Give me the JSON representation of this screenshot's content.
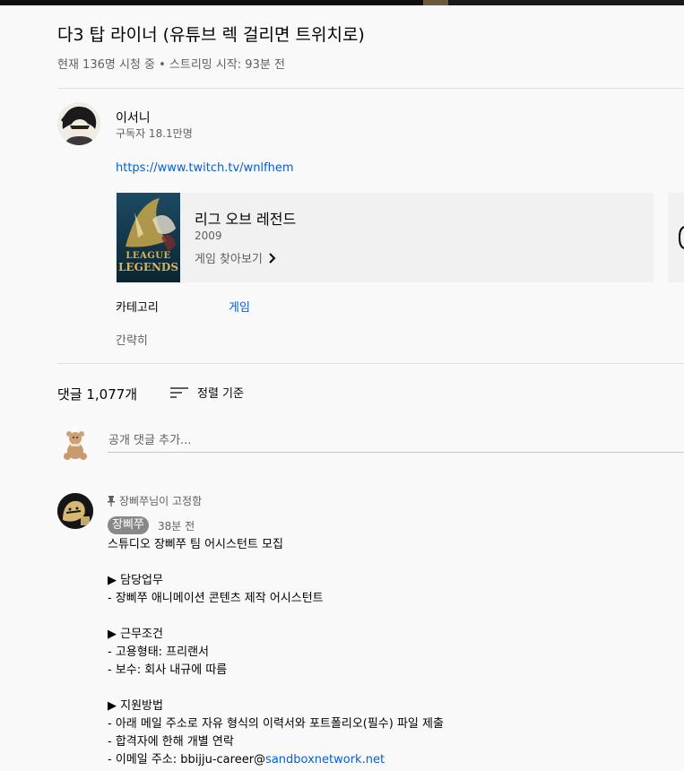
{
  "video": {
    "title": "다3 탑 라이너 (유튜브 렉 걸리면 트위치로)",
    "meta": "현재 136명 시청 중 • 스트리밍 시작: 93분 전"
  },
  "owner": {
    "name": "이서니",
    "subscribers": "구독자 18.1만명"
  },
  "description": {
    "link": "https://www.twitch.tv/wnlfhem"
  },
  "game": {
    "title": "리그 오브 레전드",
    "year": "2009",
    "browse_label": "게임 찾아보기",
    "thumb_text_1": "LEAGUE",
    "thumb_text_2": "LEGENDS"
  },
  "category": {
    "label": "카테고리",
    "value": "게임"
  },
  "collapse_label": "간략히",
  "comments": {
    "count_label": "댓글 1,077개",
    "sort_label": "정렬 기준",
    "placeholder": "공개 댓글 추가..."
  },
  "pinned_comment": {
    "pinned_label": "장삐쭈님이 고정함",
    "author": "장삐쭈",
    "time": "38분 전",
    "lines": [
      "스튜디오 장삐쭈 팀 어시스턴트 모집",
      "",
      "▶ 담당업무",
      "- 장삐쭈 애니메이션 콘텐츠 제작 어시스턴트",
      "",
      "▶ 근무조건",
      "- 고용형태: 프리랜서",
      "- 보수: 회사 내규에 따름",
      "",
      "▶ 지원방법",
      "- 아래 메일 주소로 자유 형식의 이력서와 포트폴리오(필수) 파일 제출",
      "- 합격자에 한해 개별 연락"
    ],
    "email_prefix": "- 이메일 주소: bbijju-career@",
    "email_link": "sandboxnetwork.net"
  },
  "colors": {
    "link": "#065fd4",
    "secondary_text": "#606060",
    "card_bg": "#f1f1f1",
    "author_badge": "#888888"
  }
}
